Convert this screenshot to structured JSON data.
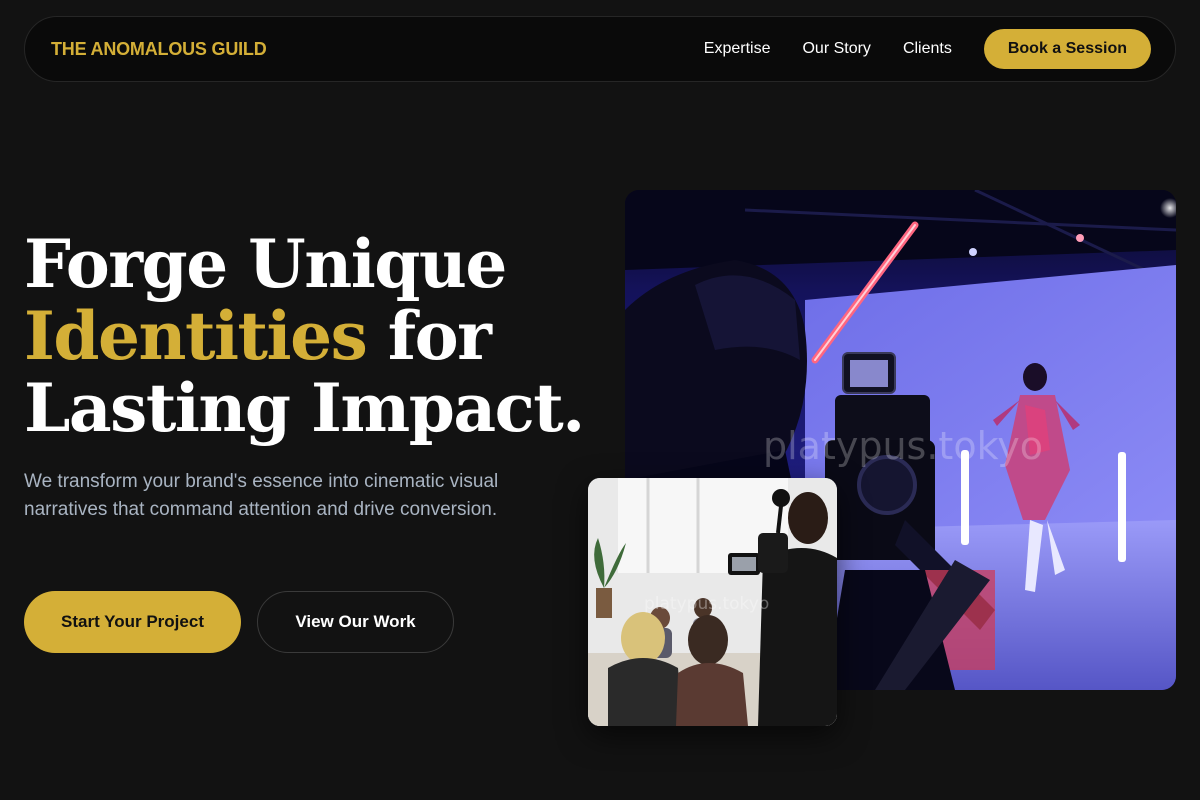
{
  "brand": {
    "name": "THE ANOMALOUS GUILD"
  },
  "nav": {
    "links": [
      "Expertise",
      "Our Story",
      "Clients"
    ],
    "cta_label": "Book a Session"
  },
  "hero": {
    "headline_line1": "Forge Unique",
    "headline_accent": "Identities",
    "headline_line2_rest": " for",
    "headline_line3": "Lasting Impact.",
    "subtext": "We transform your brand's essence into cinematic visual narratives that command attention and drive conversion.",
    "primary_button": "Start Your Project",
    "secondary_button": "View Our Work"
  },
  "images": {
    "main": {
      "watermark": "platypus.tokyo"
    },
    "secondary": {
      "watermark": "platypus.tokyo"
    }
  },
  "colors": {
    "background": "#121212",
    "accent_gold": "#d4af37",
    "subtext": "#a9b4c2"
  }
}
